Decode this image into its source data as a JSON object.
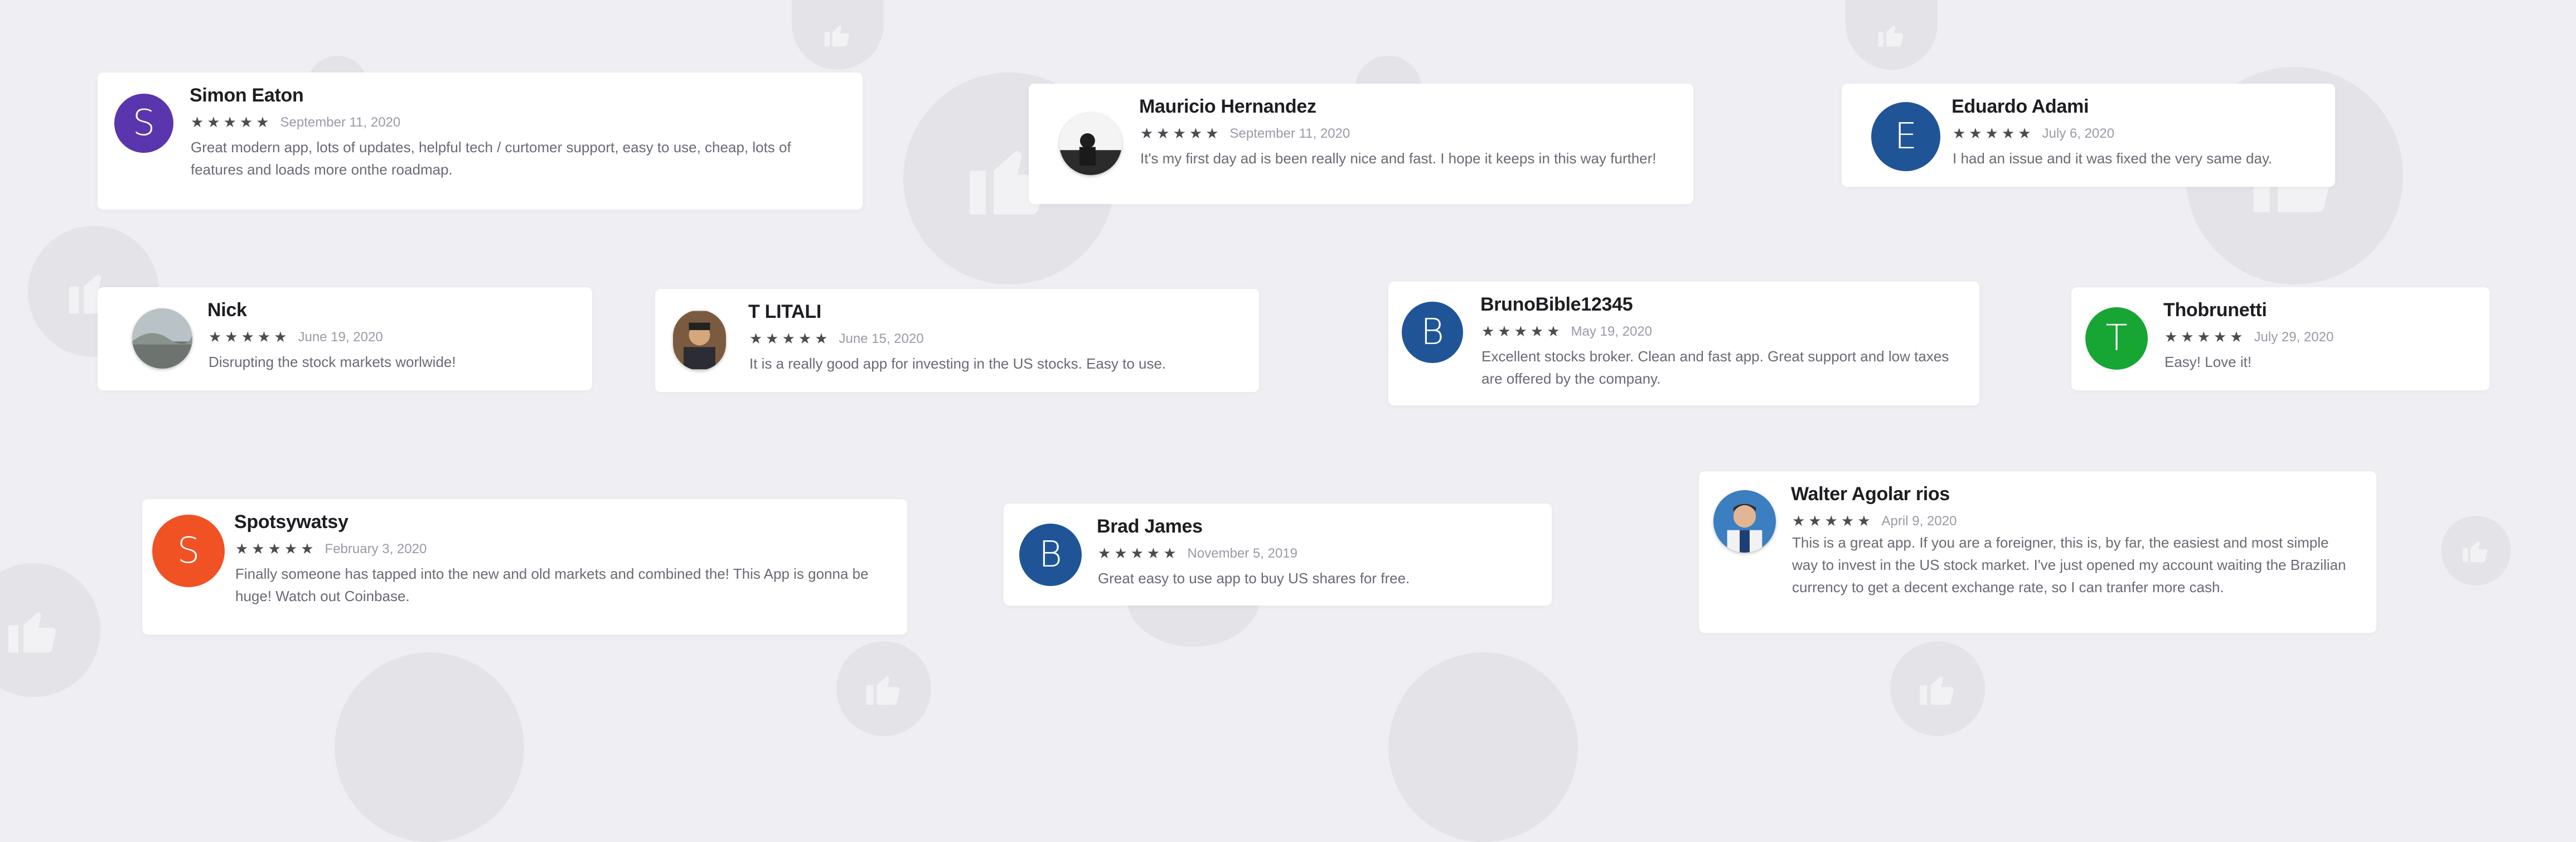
{
  "reviews": [
    {
      "name": "Simon Eaton",
      "initial": "S",
      "stars": "★★★★★",
      "date": "September 11, 2020",
      "text": "Great modern app, lots of updates, helpful tech / curtomer support, easy to use, cheap, lots of features and loads more onthe roadmap.",
      "avatar_color": "#5b35ad"
    },
    {
      "name": "Mauricio Hernandez",
      "stars": "★★★★★",
      "date": "September 11, 2020",
      "text": "It's my first day ad is been really nice and fast. I hope it keeps in this way further!"
    },
    {
      "name": "Eduardo Adami",
      "initial": "E",
      "stars": "★★★★★",
      "date": "July 6, 2020",
      "text": "I had an issue and it was fixed the very same day.",
      "avatar_color": "#1f5597"
    },
    {
      "name": "Nick",
      "stars": "★★★★★",
      "date": "June 19, 2020",
      "text": "Disrupting the stock markets worlwide!"
    },
    {
      "name": "T LITALI",
      "stars": "★★★★★",
      "date": "June 15, 2020",
      "text": "It is a really good app for investing in the US stocks. Easy to use."
    },
    {
      "name": "BrunoBible12345",
      "initial": "B",
      "stars": "★★★★★",
      "date": "May 19, 2020",
      "text": "Excellent stocks broker. Clean and fast app. Great support and low taxes are offered by the company.",
      "avatar_color": "#1f5597"
    },
    {
      "name": "Thobrunetti",
      "initial": "T",
      "stars": "★★★★★",
      "date": "July 29, 2020",
      "text": "Easy! Love it!",
      "avatar_color": "#17a534"
    },
    {
      "name": "Spotsywatsy",
      "initial": "S",
      "stars": "★★★★★",
      "date": "February 3, 2020",
      "text": "Finally someone has tapped into the new and old markets and combined the! This App is gonna be huge! Watch out Coinbase.",
      "avatar_color": "#f05223"
    },
    {
      "name": "Brad James",
      "initial": "B",
      "stars": "★★★★★",
      "date": "November 5, 2019",
      "text": "Great easy to use app to buy US shares for free.",
      "avatar_color": "#1f5597"
    },
    {
      "name": "Walter Agolar rios",
      "stars": "★★★★★",
      "date": "April 9, 2020",
      "text": "This is a great app. If you are a foreigner, this is, by far, the easiest and most simple way to invest in the US stock market. I've just opened my account waiting the Brazilian currency to get a decent exchange rate, so I can tranfer more cash."
    }
  ],
  "icons": {
    "background": "thumbs-up-icon",
    "rating": "star-icon"
  }
}
